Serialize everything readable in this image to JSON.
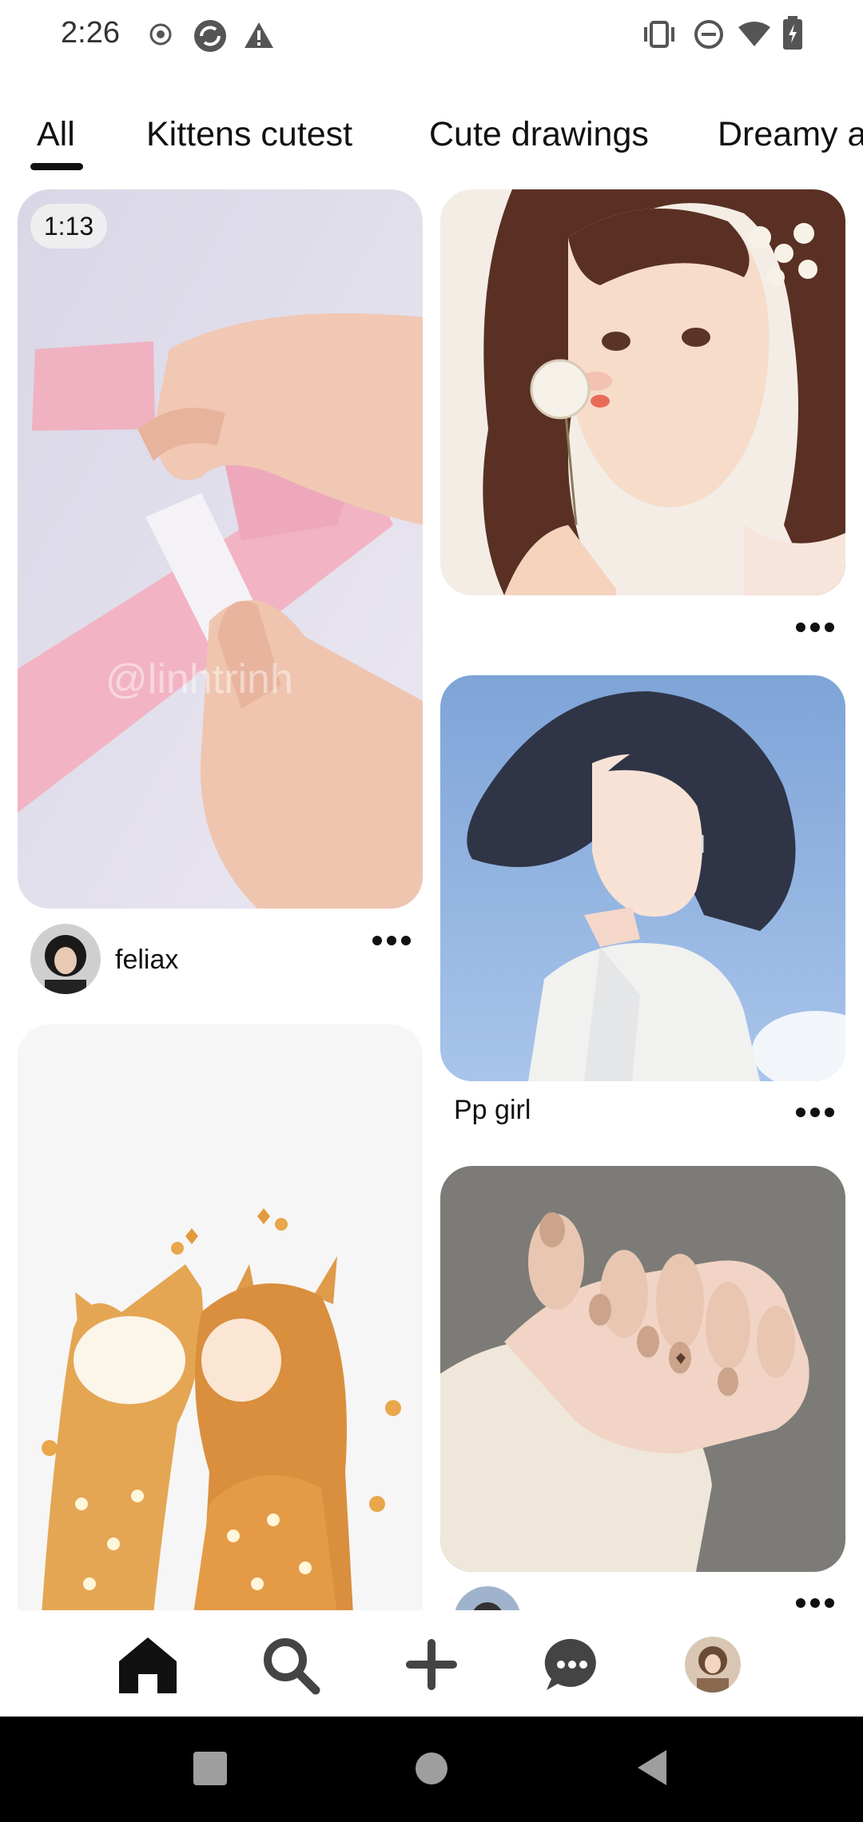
{
  "status_bar": {
    "time": "2:26",
    "left_icons": [
      "record-icon",
      "sync-icon",
      "warning-icon"
    ],
    "right_icons": [
      "vibrate-icon",
      "dnd-icon",
      "wifi-icon",
      "battery-icon"
    ]
  },
  "tabs": [
    {
      "label": "All",
      "selected": true
    },
    {
      "label": "Kittens cutest",
      "selected": false
    },
    {
      "label": "Cute drawings",
      "selected": false
    },
    {
      "label": "Dreamy a",
      "selected": false
    }
  ],
  "feed": {
    "video_pin": {
      "duration": "1:13",
      "creator": "feliax",
      "watermark": "@linhtrinh"
    },
    "girl_dandelion_pin": {},
    "pp_girl_pin": {
      "title": "Pp girl"
    },
    "nails_pin": {},
    "cat_girl_pin": {}
  },
  "bottom_nav": [
    {
      "icon": "home-icon",
      "active": true
    },
    {
      "icon": "search-icon",
      "active": false
    },
    {
      "icon": "plus-icon",
      "active": false
    },
    {
      "icon": "chat-icon",
      "active": false
    },
    {
      "icon": "profile-avatar",
      "active": false
    }
  ],
  "system_nav": [
    "recents-square-icon",
    "home-circle-icon",
    "back-triangle-icon"
  ]
}
